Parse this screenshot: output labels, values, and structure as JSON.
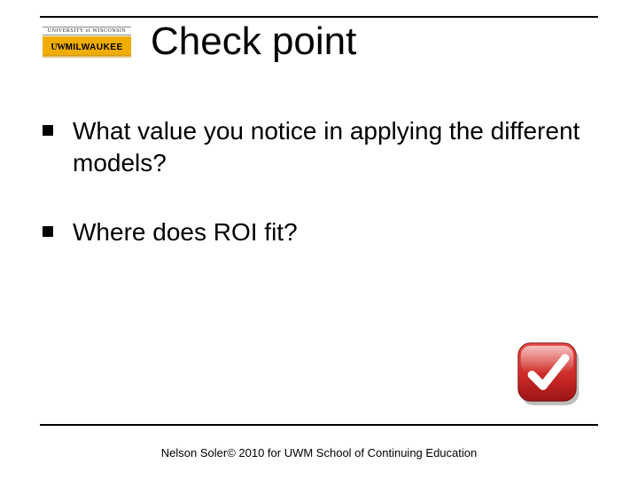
{
  "logo": {
    "university_line": "UNIVERSITY of WISCONSIN",
    "uw_prefix": "UW",
    "campus": "MILWAUKEE"
  },
  "title": "Check point",
  "bullets": [
    "What value you notice in applying the different models?",
    "Where does ROI fit?"
  ],
  "footer": "Nelson Soler© 2010 for UWM School of Continuing Education",
  "icons": {
    "check": "checkmark-icon"
  },
  "colors": {
    "gold": "#f0ad00",
    "check_red_top": "#e44b47",
    "check_red_bottom": "#b71b1d",
    "check_tick": "#ffffff"
  }
}
